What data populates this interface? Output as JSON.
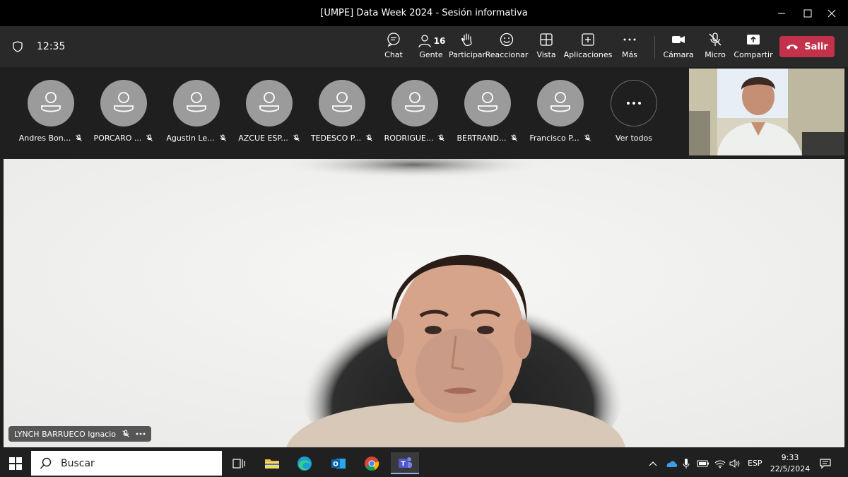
{
  "window": {
    "title": "[UMPE] Data Week 2024 - Sesión informativa"
  },
  "toolbar": {
    "timer": "12:35",
    "people_count": "16",
    "buttons": {
      "chat": "Chat",
      "people": "Gente",
      "raise": "Participar",
      "react": "Reaccionar",
      "view": "Vista",
      "apps": "Aplicaciones",
      "more": "Más",
      "camera": "Cámara",
      "mic": "Micro",
      "share": "Compartir"
    },
    "leave": "Salir"
  },
  "participants": [
    {
      "name": "Andres Bon..."
    },
    {
      "name": "PORCARO ..."
    },
    {
      "name": "Agustin Le..."
    },
    {
      "name": "AZCUE ESP..."
    },
    {
      "name": "TEDESCO P..."
    },
    {
      "name": "RODRIGUE..."
    },
    {
      "name": "BERTRAND..."
    },
    {
      "name": "Francisco P..."
    }
  ],
  "see_all": "Ver todos",
  "speaker": {
    "name": "LYNCH BARRUECO Ignacio"
  },
  "taskbar": {
    "search_placeholder": "Buscar",
    "language": "ESP",
    "time": "9:33",
    "date": "22/5/2024"
  },
  "colors": {
    "leave": "#c4314b",
    "titlebar": "#000000",
    "toolbar": "#292929",
    "avatar": "#9b9b9b"
  }
}
